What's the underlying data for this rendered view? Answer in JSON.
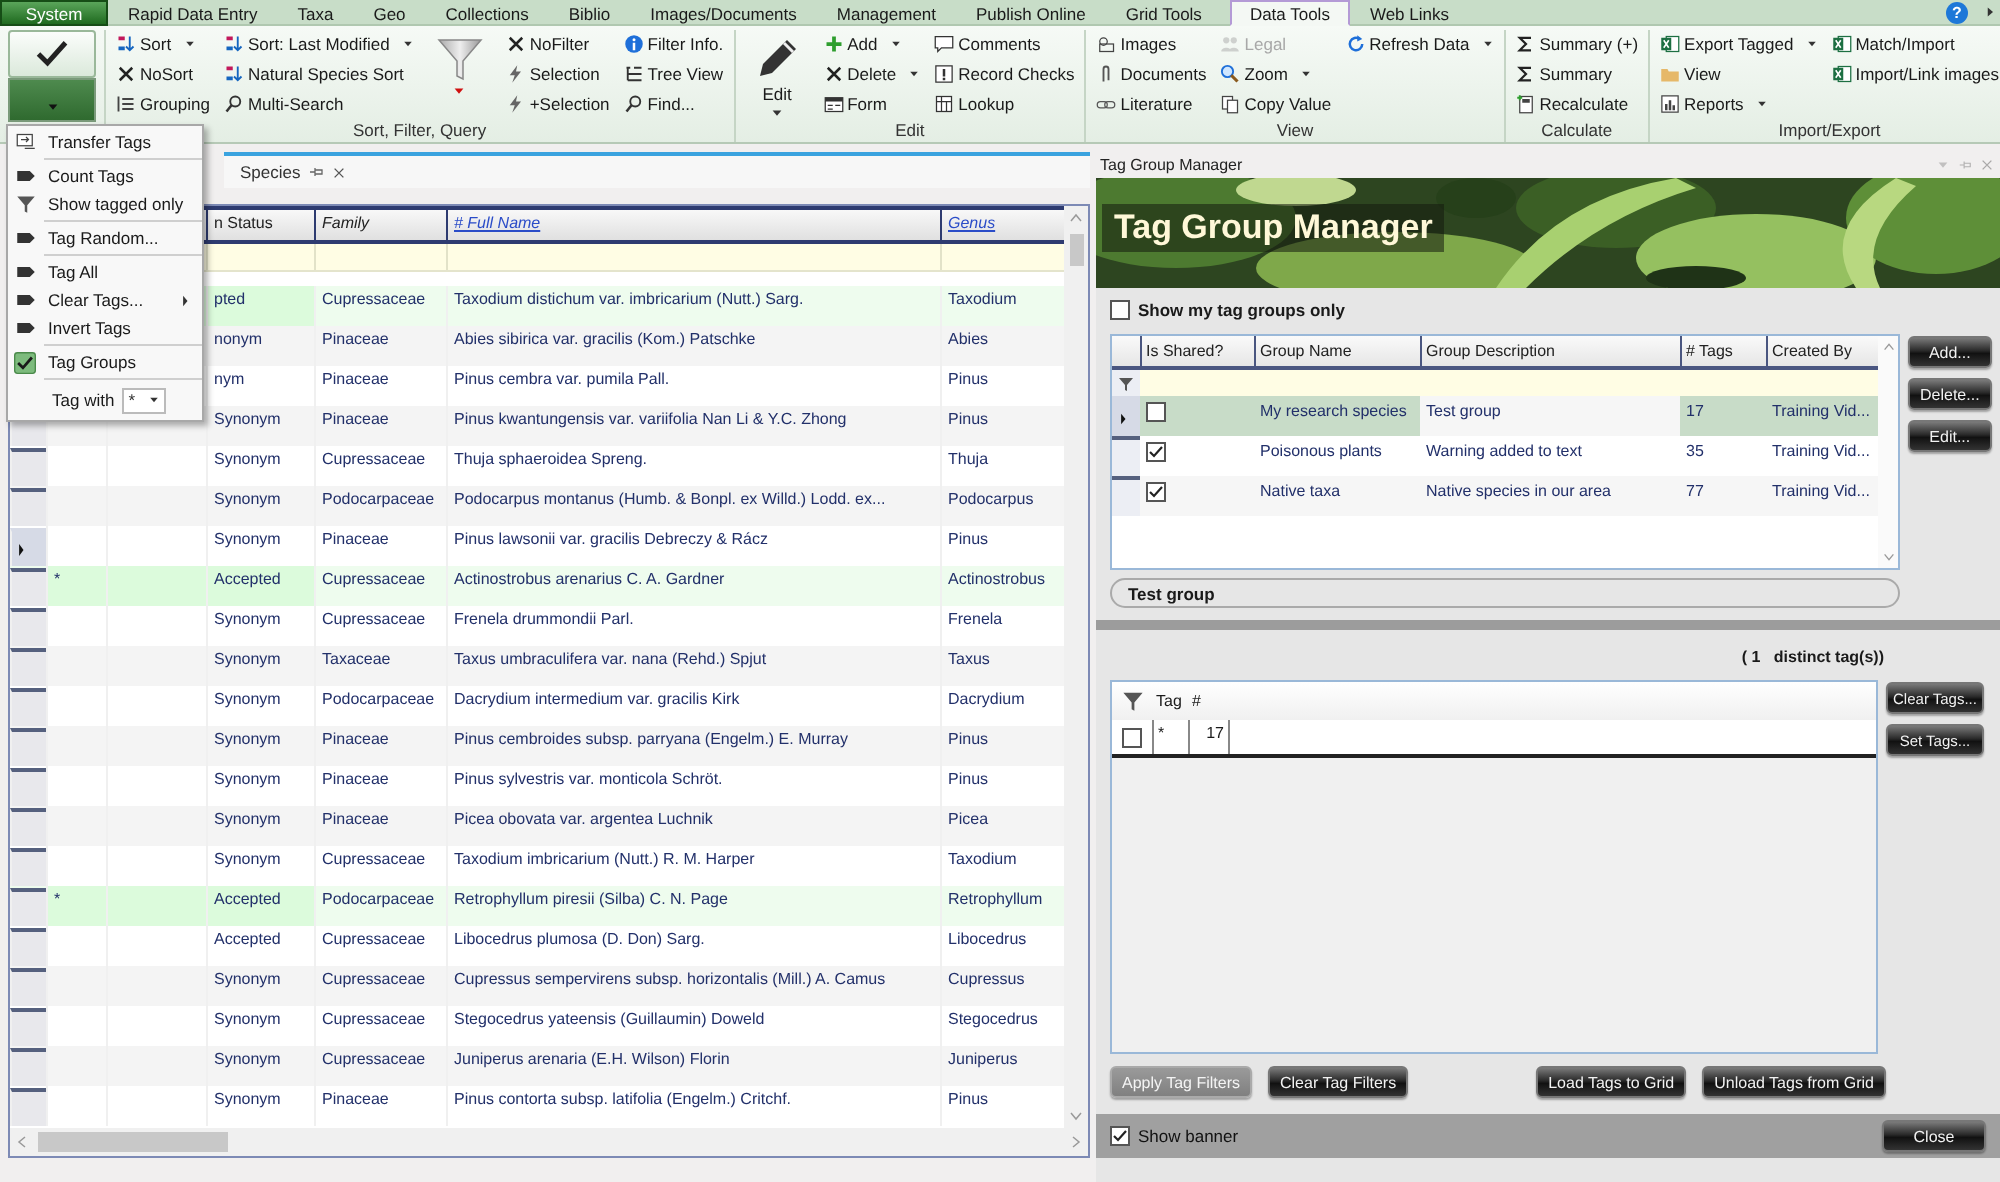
{
  "app_tabs": [
    {
      "label": "System",
      "kind": "app",
      "selected": false
    },
    {
      "label": "Rapid Data Entry",
      "kind": "tab",
      "selected": false
    },
    {
      "label": "Taxa",
      "kind": "tab",
      "selected": false
    },
    {
      "label": "Geo",
      "kind": "tab",
      "selected": false
    },
    {
      "label": "Collections",
      "kind": "tab",
      "selected": false
    },
    {
      "label": "Biblio",
      "kind": "tab",
      "selected": false
    },
    {
      "label": "Images/Documents",
      "kind": "tab",
      "selected": false
    },
    {
      "label": "Management",
      "kind": "tab",
      "selected": false
    },
    {
      "label": "Publish Online",
      "kind": "tab",
      "selected": false
    },
    {
      "label": "Grid Tools",
      "kind": "tab",
      "selected": false
    },
    {
      "label": "Data Tools",
      "kind": "tab",
      "selected": true
    },
    {
      "label": "Web Links",
      "kind": "tab",
      "selected": false
    }
  ],
  "help": "?",
  "ribbon": {
    "groups": [
      {
        "kind": "tag",
        "menu_open": true
      },
      {
        "kind": "buttons",
        "label": "Sort, Filter, Query",
        "columns": [
          [
            {
              "kind": "small",
              "label": "Sort",
              "dropdown": true,
              "disabled": false
            },
            {
              "kind": "small",
              "label": "NoSort",
              "dropdown": false,
              "disabled": false
            },
            {
              "kind": "small",
              "label": "Grouping",
              "dropdown": false,
              "disabled": false
            }
          ],
          [
            {
              "kind": "small",
              "label": "Sort: Last Modified",
              "dropdown": true,
              "disabled": false
            },
            {
              "kind": "small",
              "label": "Natural Species Sort",
              "dropdown": false,
              "disabled": false
            },
            {
              "kind": "small",
              "label": "Multi-Search",
              "dropdown": false,
              "disabled": false
            }
          ],
          [
            {
              "kind": "large",
              "dropdown": true,
              "disabled": false
            }
          ],
          [
            {
              "kind": "small",
              "label": "NoFilter",
              "dropdown": false,
              "disabled": false
            },
            {
              "kind": "small",
              "label": "Selection",
              "dropdown": false,
              "disabled": false
            },
            {
              "kind": "small",
              "label": "+Selection",
              "dropdown": false,
              "disabled": false
            }
          ],
          [
            {
              "kind": "small",
              "label": "Filter Info.",
              "dropdown": false,
              "disabled": false
            },
            {
              "kind": "small",
              "label": "Tree View",
              "dropdown": false,
              "disabled": false
            },
            {
              "kind": "small",
              "label": "Find...",
              "dropdown": false,
              "disabled": false
            }
          ]
        ]
      },
      {
        "kind": "buttons",
        "label": "Edit",
        "columns": [
          [
            {
              "kind": "large",
              "label": "Edit",
              "dropdown": true,
              "disabled": false
            }
          ],
          [
            {
              "kind": "small",
              "label": "Add",
              "dropdown": true,
              "disabled": false
            },
            {
              "kind": "small",
              "label": "Delete",
              "dropdown": true,
              "disabled": false
            },
            {
              "kind": "small",
              "label": "Form",
              "dropdown": false,
              "disabled": false
            }
          ],
          [
            {
              "kind": "small",
              "label": "Comments",
              "dropdown": false,
              "disabled": false
            },
            {
              "kind": "small",
              "label": "Record Checks",
              "dropdown": false,
              "disabled": false
            },
            {
              "kind": "small",
              "label": "Lookup",
              "dropdown": false,
              "disabled": false
            }
          ]
        ]
      },
      {
        "kind": "buttons",
        "label": "View",
        "columns": [
          [
            {
              "kind": "small",
              "label": "Images",
              "dropdown": false,
              "disabled": false
            },
            {
              "kind": "small",
              "label": "Documents",
              "dropdown": false,
              "disabled": false
            },
            {
              "kind": "small",
              "label": "Literature",
              "dropdown": false,
              "disabled": false
            }
          ],
          [
            {
              "kind": "small",
              "label": "Legal",
              "dropdown": false,
              "disabled": true
            },
            {
              "kind": "small",
              "label": "Zoom",
              "dropdown": true,
              "disabled": false
            },
            {
              "kind": "small",
              "label": "Copy Value",
              "dropdown": false,
              "disabled": false
            }
          ],
          [
            {
              "kind": "small",
              "label": "Refresh Data",
              "dropdown": true,
              "disabled": false
            }
          ]
        ]
      },
      {
        "kind": "buttons",
        "label": "Calculate",
        "columns": [
          [
            {
              "kind": "small",
              "label": "Summary (+)",
              "dropdown": false,
              "disabled": false
            },
            {
              "kind": "small",
              "label": "Summary",
              "dropdown": false,
              "disabled": false
            },
            {
              "kind": "small",
              "label": "Recalculate",
              "dropdown": false,
              "disabled": false
            }
          ]
        ]
      },
      {
        "kind": "buttons",
        "label": "Import/Export",
        "columns": [
          [
            {
              "kind": "small",
              "label": "Export Tagged",
              "dropdown": true,
              "disabled": false
            },
            {
              "kind": "small",
              "label": "View",
              "dropdown": false,
              "disabled": false
            },
            {
              "kind": "small",
              "label": "Reports",
              "dropdown": true,
              "disabled": false
            }
          ],
          [
            {
              "kind": "small",
              "label": "Match/Import",
              "dropdown": false,
              "disabled": false
            },
            {
              "kind": "small",
              "label": "Import/Link images",
              "dropdown": false,
              "disabled": false
            }
          ]
        ]
      }
    ]
  },
  "tag_menu": {
    "sections": [
      [
        {
          "label": "Transfer Tags",
          "submenu": false,
          "checked": false
        }
      ],
      [
        {
          "label": "Count Tags",
          "submenu": false,
          "checked": false
        },
        {
          "label": "Show tagged only",
          "submenu": false,
          "checked": false
        }
      ],
      [
        {
          "label": "Tag Random...",
          "submenu": false,
          "checked": false
        }
      ],
      [
        {
          "label": "Tag All",
          "submenu": false,
          "checked": false
        },
        {
          "label": "Clear Tags...",
          "submenu": true,
          "checked": false
        },
        {
          "label": "Invert Tags",
          "submenu": false,
          "checked": false
        }
      ],
      [
        {
          "label": "Tag Groups",
          "submenu": false,
          "checked": true
        }
      ]
    ],
    "tag_with": {
      "label": "Tag with",
      "value": "*"
    }
  },
  "document_tab": {
    "label": "Species",
    "selected": true
  },
  "species_grid": {
    "columns": [
      {
        "label": "n Status",
        "kind": "plain"
      },
      {
        "label": "Family",
        "kind": "italic"
      },
      {
        "label": "# Full Name",
        "kind": "link"
      },
      {
        "label": "Genus",
        "kind": "link"
      }
    ],
    "rows": [
      {
        "status": "pted",
        "family": "Cupressaceae",
        "full_name": "Taxodium distichum var. imbricarium (Nutt.) Sarg.",
        "genus": "Taxodium",
        "tagged": true
      },
      {
        "status": "nonym",
        "family": "Pinaceae",
        "full_name": "Abies sibirica var. gracilis (Kom.) Patschke",
        "genus": "Abies",
        "tagged": false
      },
      {
        "status": "nym",
        "family": "Pinaceae",
        "full_name": "Pinus cembra var. pumila Pall.",
        "genus": "Pinus",
        "tagged": false
      },
      {
        "status": "Synonym",
        "family": "Pinaceae",
        "full_name": "Pinus kwantungensis var. variifolia Nan Li & Y.C. Zhong",
        "genus": "Pinus",
        "tagged": false,
        "current": false
      },
      {
        "status": "Synonym",
        "family": "Cupressaceae",
        "full_name": "Thuja sphaeroidea Spreng.",
        "genus": "Thuja",
        "tagged": false,
        "current": false
      },
      {
        "status": "Synonym",
        "family": "Podocarpaceae",
        "full_name": "Podocarpus montanus (Humb. & Bonpl. ex Willd.) Lodd. ex...",
        "genus": "Podocarpus",
        "tagged": false,
        "current": false
      },
      {
        "status": "Synonym",
        "family": "Pinaceae",
        "full_name": "Pinus lawsonii var. gracilis Debreczy & Rácz",
        "genus": "Pinus",
        "tagged": false,
        "current": true
      },
      {
        "tag": "*",
        "status": "Accepted",
        "family": "Cupressaceae",
        "full_name": "Actinostrobus arenarius C. A. Gardner",
        "genus": "Actinostrobus",
        "tagged": true,
        "current": false
      },
      {
        "status": "Synonym",
        "family": "Cupressaceae",
        "full_name": "Frenela drummondii Parl.",
        "genus": "Frenela",
        "tagged": false,
        "current": false
      },
      {
        "status": "Synonym",
        "family": "Taxaceae",
        "full_name": "Taxus umbraculifera var. nana (Rehd.) Spjut",
        "genus": "Taxus",
        "tagged": false,
        "current": false
      },
      {
        "status": "Synonym",
        "family": "Podocarpaceae",
        "full_name": "Dacrydium intermedium var. gracilis Kirk",
        "genus": "Dacrydium",
        "tagged": false,
        "current": false
      },
      {
        "status": "Synonym",
        "family": "Pinaceae",
        "full_name": "Pinus cembroides subsp. parryana (Engelm.) E. Murray",
        "genus": "Pinus",
        "tagged": false,
        "current": false
      },
      {
        "status": "Synonym",
        "family": "Pinaceae",
        "full_name": "Pinus sylvestris var. monticola Schröt.",
        "genus": "Pinus",
        "tagged": false,
        "current": false
      },
      {
        "status": "Synonym",
        "family": "Pinaceae",
        "full_name": "Picea obovata var. argentea Luchnik",
        "genus": "Picea",
        "tagged": false,
        "current": false
      },
      {
        "status": "Synonym",
        "family": "Cupressaceae",
        "full_name": "Taxodium imbricarium (Nutt.) R. M. Harper",
        "genus": "Taxodium",
        "tagged": false,
        "current": false
      },
      {
        "tag": "*",
        "status": "Accepted",
        "family": "Podocarpaceae",
        "full_name": "Retrophyllum piresii (Silba) C. N. Page",
        "genus": "Retrophyllum",
        "tagged": true,
        "current": false
      },
      {
        "status": "Accepted",
        "family": "Cupressaceae",
        "full_name": "Libocedrus plumosa (D. Don) Sarg.",
        "genus": "Libocedrus",
        "tagged": false,
        "current": false
      },
      {
        "status": "Synonym",
        "family": "Cupressaceae",
        "full_name": "Cupressus sempervirens subsp. horizontalis (Mill.) A. Camus",
        "genus": "Cupressus",
        "tagged": false,
        "current": false
      },
      {
        "status": "Synonym",
        "family": "Cupressaceae",
        "full_name": "Stegocedrus yateensis (Guillaumin) Doweld",
        "genus": "Stegocedrus",
        "tagged": false,
        "current": false
      },
      {
        "status": "Synonym",
        "family": "Cupressaceae",
        "full_name": "Juniperus arenaria (E.H. Wilson) Florin",
        "genus": "Juniperus",
        "tagged": false,
        "current": false
      },
      {
        "status": "Synonym",
        "family": "Pinaceae",
        "full_name": "Pinus contorta subsp. latifolia (Engelm.) Critchf.",
        "genus": "Pinus",
        "tagged": false,
        "current": false
      }
    ]
  },
  "tag_group_manager": {
    "title": "Tag Group Manager",
    "banner_title": "Tag Group Manager",
    "show_mine": {
      "label": "Show my tag groups only",
      "checked": false
    },
    "groups": {
      "columns": [
        "Is Shared?",
        "Group Name",
        "Group Description",
        "# Tags",
        "Created By"
      ],
      "rows": [
        {
          "shared": false,
          "name": "My research species",
          "description": "Test group",
          "tags": "17",
          "created_by": "Training Vid...",
          "selected": true
        },
        {
          "shared": true,
          "name": "Poisonous plants",
          "description": "Warning added to text",
          "tags": "35",
          "created_by": "Training Vid...",
          "selected": false
        },
        {
          "shared": true,
          "name": "Native taxa",
          "description": "Native species in our area",
          "tags": "77",
          "created_by": "Training Vid...",
          "selected": false
        }
      ]
    },
    "group_buttons": [
      {
        "label": "Add...",
        "disabled": false
      },
      {
        "label": "Delete...",
        "disabled": false
      },
      {
        "label": "Edit...",
        "disabled": false
      }
    ],
    "current_group": "Test group",
    "distinct_count": "( 1   distinct tag(s))",
    "tags": {
      "columns": [
        "Tag",
        "#"
      ],
      "rows": [
        {
          "checked": false,
          "tag": "*",
          "count": "17"
        }
      ]
    },
    "tag_buttons": [
      {
        "label": "Clear Tags...",
        "disabled": false
      },
      {
        "label": "Set Tags...",
        "disabled": false
      }
    ],
    "filter_buttons": [
      {
        "label": "Apply Tag Filters",
        "disabled": true
      },
      {
        "label": "Clear Tag Filters",
        "disabled": false
      }
    ],
    "grid_buttons": [
      {
        "label": "Load Tags to Grid",
        "disabled": false
      },
      {
        "label": "Unload Tags from Grid",
        "disabled": false
      }
    ],
    "show_banner": {
      "label": "Show banner",
      "checked": true
    },
    "close": "Close"
  }
}
